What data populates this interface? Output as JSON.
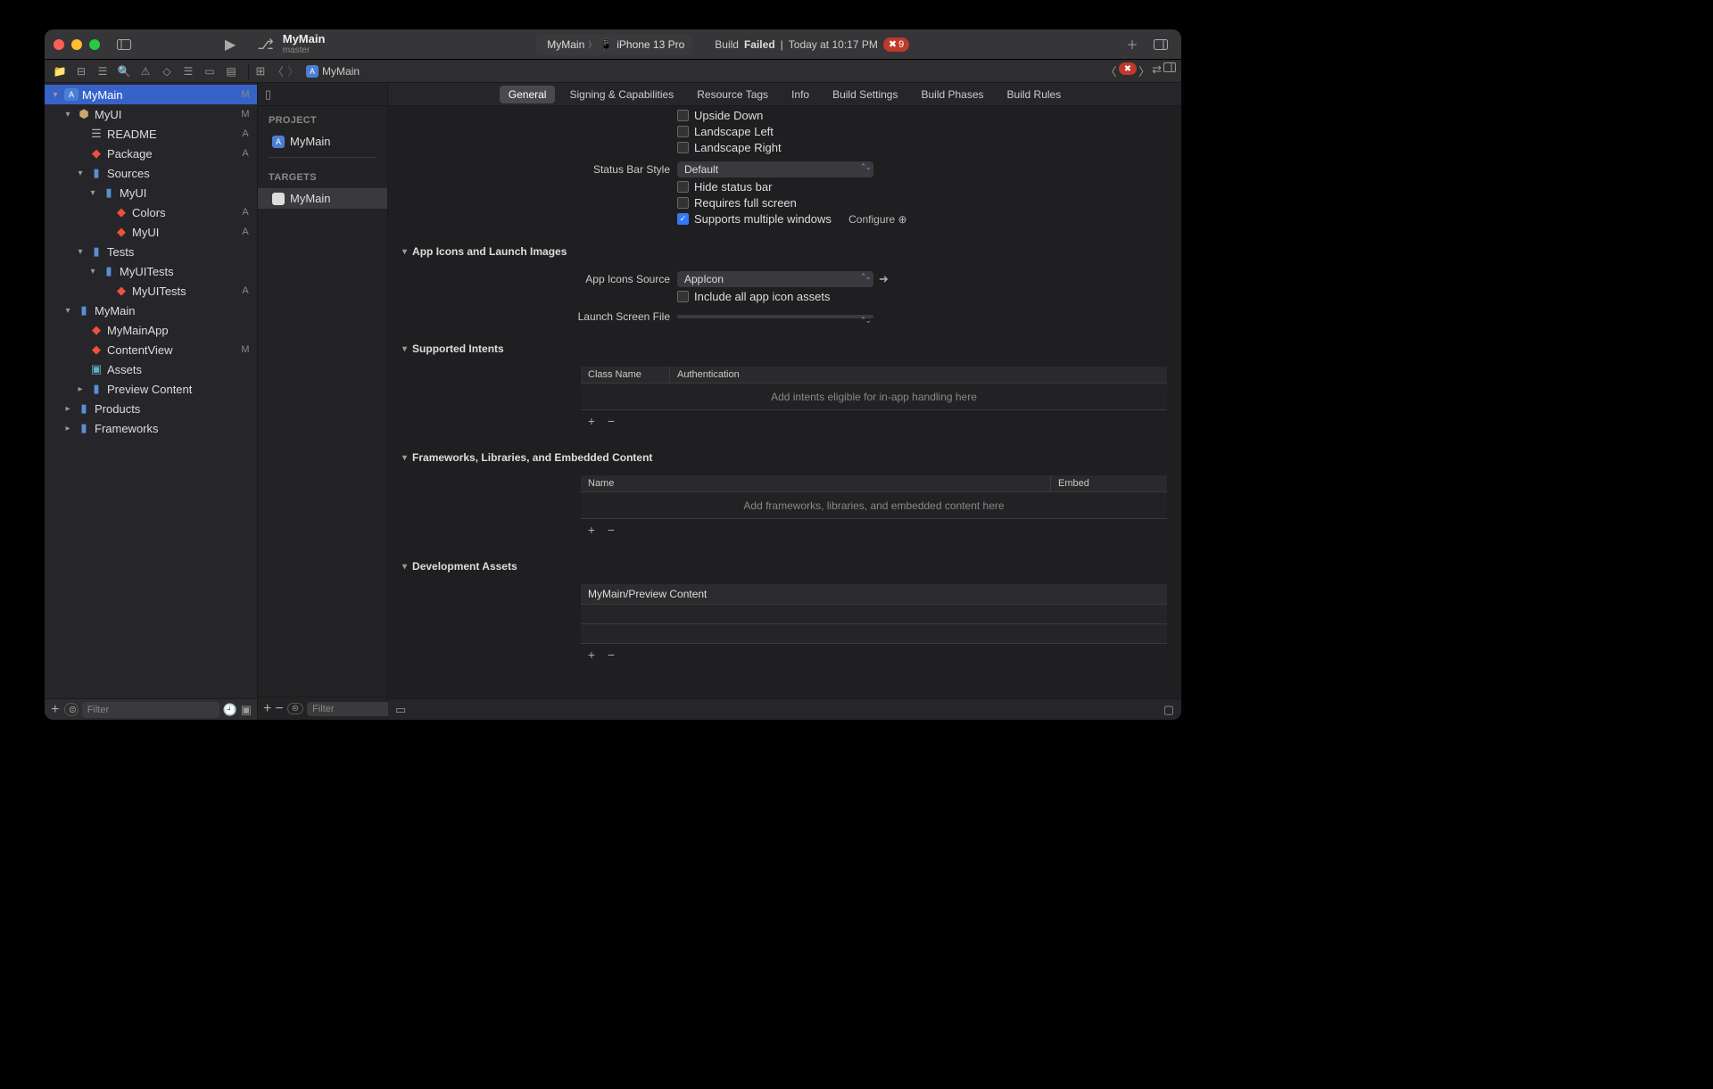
{
  "window": {
    "title": "MyMain",
    "branch": "master",
    "scheme": "MyMain",
    "device": "iPhone 13 Pro",
    "buildStatus": "Build",
    "buildResult": "Failed",
    "buildTime": "Today at 10:17 PM",
    "errorCount": "9"
  },
  "breadcrumb": {
    "item": "MyMain"
  },
  "navigator": {
    "filterPlaceholder": "Filter",
    "tree": [
      {
        "indent": 0,
        "disc": "▾",
        "iconCls": "app-icon-sm",
        "iconTxt": "",
        "label": "MyMain",
        "badge": "M",
        "selected": true,
        "name": "proj-mymain"
      },
      {
        "indent": 1,
        "disc": "▾",
        "iconCls": "pkg-icon",
        "iconTxt": "📦",
        "label": "MyUI",
        "badge": "M",
        "name": "pkg-myui"
      },
      {
        "indent": 2,
        "disc": "",
        "iconCls": "readme-icon",
        "iconTxt": "📖",
        "label": "README",
        "badge": "A",
        "name": "file-readme"
      },
      {
        "indent": 2,
        "disc": "",
        "iconCls": "swift-icon",
        "iconTxt": "🔶",
        "label": "Package",
        "badge": "A",
        "name": "file-package"
      },
      {
        "indent": 2,
        "disc": "▾",
        "iconCls": "folder-icon",
        "iconTxt": "📁",
        "label": "Sources",
        "badge": "",
        "name": "folder-sources"
      },
      {
        "indent": 3,
        "disc": "▾",
        "iconCls": "folder-icon",
        "iconTxt": "📁",
        "label": "MyUI",
        "badge": "",
        "name": "folder-myui"
      },
      {
        "indent": 4,
        "disc": "",
        "iconCls": "swift-icon",
        "iconTxt": "🔶",
        "label": "Colors",
        "badge": "A",
        "name": "file-colors"
      },
      {
        "indent": 4,
        "disc": "",
        "iconCls": "swift-icon",
        "iconTxt": "🔶",
        "label": "MyUI",
        "badge": "A",
        "name": "file-myui"
      },
      {
        "indent": 2,
        "disc": "▾",
        "iconCls": "folder-icon",
        "iconTxt": "📁",
        "label": "Tests",
        "badge": "",
        "name": "folder-tests"
      },
      {
        "indent": 3,
        "disc": "▾",
        "iconCls": "folder-icon",
        "iconTxt": "📁",
        "label": "MyUITests",
        "badge": "",
        "name": "folder-myuitests"
      },
      {
        "indent": 4,
        "disc": "",
        "iconCls": "swift-icon",
        "iconTxt": "🔶",
        "label": "MyUITests",
        "badge": "A",
        "name": "file-myuitests"
      },
      {
        "indent": 1,
        "disc": "▾",
        "iconCls": "folder-icon",
        "iconTxt": "📁",
        "label": "MyMain",
        "badge": "",
        "name": "folder-mymain"
      },
      {
        "indent": 2,
        "disc": "",
        "iconCls": "swift-icon",
        "iconTxt": "🔶",
        "label": "MyMainApp",
        "badge": "",
        "name": "file-mymainapp"
      },
      {
        "indent": 2,
        "disc": "",
        "iconCls": "swift-icon",
        "iconTxt": "🔶",
        "label": "ContentView",
        "badge": "M",
        "name": "file-contentview"
      },
      {
        "indent": 2,
        "disc": "",
        "iconCls": "assets-icon",
        "iconTxt": "🗂",
        "label": "Assets",
        "badge": "",
        "name": "file-assets"
      },
      {
        "indent": 2,
        "disc": "▸",
        "iconCls": "folder-icon",
        "iconTxt": "📁",
        "label": "Preview Content",
        "badge": "",
        "name": "folder-previewcontent"
      },
      {
        "indent": 1,
        "disc": "▸",
        "iconCls": "folder-icon",
        "iconTxt": "📁",
        "label": "Products",
        "badge": "",
        "name": "folder-products"
      },
      {
        "indent": 1,
        "disc": "▸",
        "iconCls": "folder-icon",
        "iconTxt": "📁",
        "label": "Frameworks",
        "badge": "",
        "name": "folder-frameworks"
      }
    ]
  },
  "projcol": {
    "projectHeader": "PROJECT",
    "projectName": "MyMain",
    "targetsHeader": "TARGETS",
    "targetName": "MyMain",
    "filterPlaceholder": "Filter"
  },
  "editor": {
    "tabs": [
      "General",
      "Signing & Capabilities",
      "Resource Tags",
      "Info",
      "Build Settings",
      "Build Phases",
      "Build Rules"
    ],
    "activeTab": 0,
    "orientation": {
      "upsideDown": "Upside Down",
      "landscapeLeft": "Landscape Left",
      "landscapeRight": "Landscape Right"
    },
    "statusBarLabel": "Status Bar Style",
    "statusBarValue": "Default",
    "hideStatusBar": "Hide status bar",
    "requiresFullScreen": "Requires full screen",
    "supportsMultipleWindows": "Supports multiple windows",
    "configure": "Configure",
    "sections": {
      "appIcons": {
        "title": "App Icons and Launch Images",
        "sourceLabel": "App Icons Source",
        "sourceValue": "AppIcon",
        "includeAll": "Include all app icon assets",
        "launchScreenLabel": "Launch Screen File",
        "launchScreenValue": ""
      },
      "intents": {
        "title": "Supported Intents",
        "col1": "Class Name",
        "col2": "Authentication",
        "empty": "Add intents eligible for in-app handling here"
      },
      "frameworks": {
        "title": "Frameworks, Libraries, and Embedded Content",
        "col1": "Name",
        "col2": "Embed",
        "empty": "Add frameworks, libraries, and embedded content here"
      },
      "devAssets": {
        "title": "Development Assets",
        "row1": "MyMain/Preview Content"
      }
    }
  }
}
